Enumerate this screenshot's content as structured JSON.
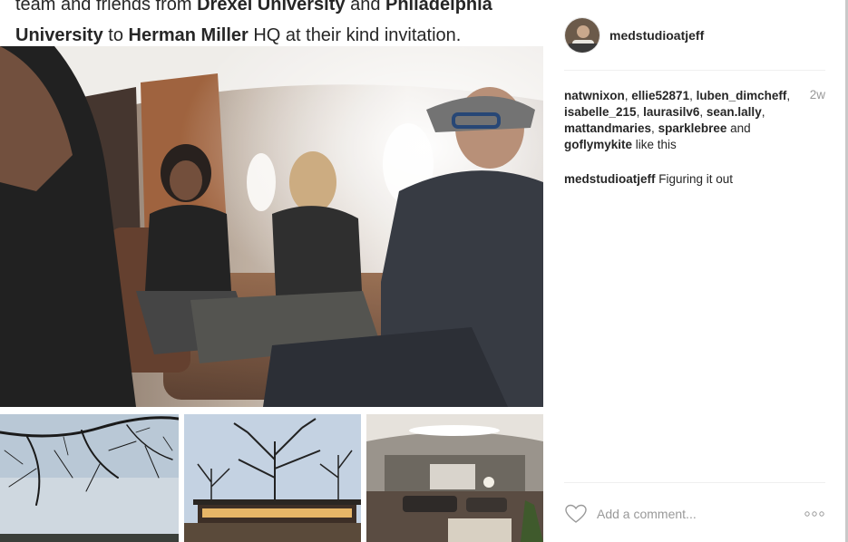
{
  "caption": {
    "line1_prefix": "team and friends from ",
    "line1_org1": "Drexel University",
    "line1_and": " and ",
    "line1_org2": "Philadelphia",
    "line2_org2": "University",
    "line2_to": " to ",
    "line2_org3": "Herman Miller",
    "line2_suffix": " HQ at their kind invitation."
  },
  "post": {
    "username": "medstudioatjeff",
    "age": "2w",
    "likes": [
      {
        "name": "natwnixon",
        "sep": ", "
      },
      {
        "name": "ellie52871",
        "sep": ", "
      },
      {
        "name": "luben_dimcheff",
        "sep": ", "
      },
      {
        "name": "isabelle_215",
        "sep": ", "
      },
      {
        "name": "laurasilv6",
        "sep": ", "
      },
      {
        "name": "sean.lally",
        "sep": ", "
      },
      {
        "name": "mattandmaries",
        "sep": ", "
      },
      {
        "name": "sparklebree",
        "sep": " and "
      },
      {
        "name": "goflymykite",
        "sep": " like this"
      }
    ],
    "comment": {
      "user": "medstudioatjeff",
      "text": " Figuring it out"
    },
    "add_comment_placeholder": "Add a comment...",
    "icons": {
      "like": "heart-outline-icon",
      "more": "more-dots-icon"
    },
    "colors": {
      "text": "#262626",
      "muted": "#999999",
      "divider": "#efefef"
    }
  }
}
